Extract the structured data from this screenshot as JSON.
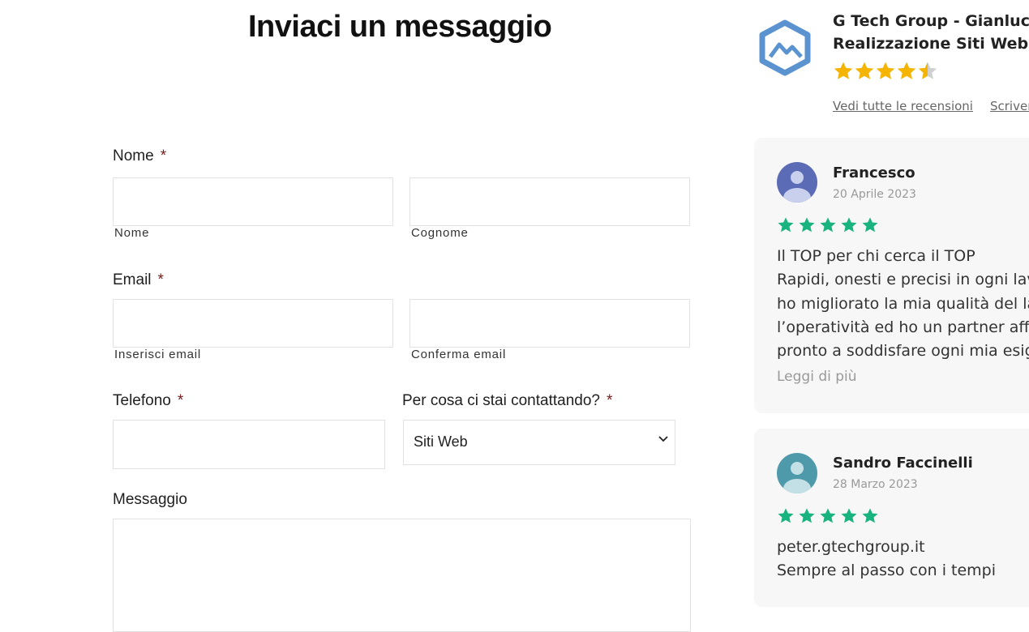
{
  "form": {
    "title": "Inviaci un messaggio",
    "required_mark": "*",
    "name": {
      "label": "Nome",
      "first_sublabel": "Nome",
      "last_sublabel": "Cognome"
    },
    "email": {
      "label": "Email",
      "enter_sublabel": "Inserisci email",
      "confirm_sublabel": "Conferma email"
    },
    "phone": {
      "label": "Telefono"
    },
    "topic": {
      "label": "Per cosa ci stai contattando?",
      "selected": "Siti Web"
    },
    "message": {
      "label": "Messaggio"
    }
  },
  "reviews_widget": {
    "business_name_line1": "G Tech Group - Gianluca",
    "business_name_line2": "Realizzazione Siti Web",
    "rating": 4.5,
    "see_all_link": "Vedi tutte le recensioni",
    "write_link": "Scriver",
    "reviews": [
      {
        "author": "Francesco",
        "date": "20 Aprile 2023",
        "stars": 5,
        "lines": [
          "Il TOP per chi cerca il TOP",
          "Rapidi, onesti e precisi in ogni lavo",
          "ho migliorato la mia qualità del la",
          "l’operatività ed ho un partner affic",
          "pronto a soddisfare ogni mia esig"
        ],
        "read_more": "Leggi di più",
        "avatar_color": "#5b6bb5"
      },
      {
        "author": "Sandro Faccinelli",
        "date": "28 Marzo 2023",
        "stars": 5,
        "lines": [
          "peter.gtechgroup.it",
          "Sempre al passo con i tempi"
        ],
        "avatar_color": "#4f9aaa"
      }
    ],
    "colors": {
      "brand_star": "#f4b400",
      "review_star": "#18b37f",
      "logo": "#5a93d0"
    }
  }
}
